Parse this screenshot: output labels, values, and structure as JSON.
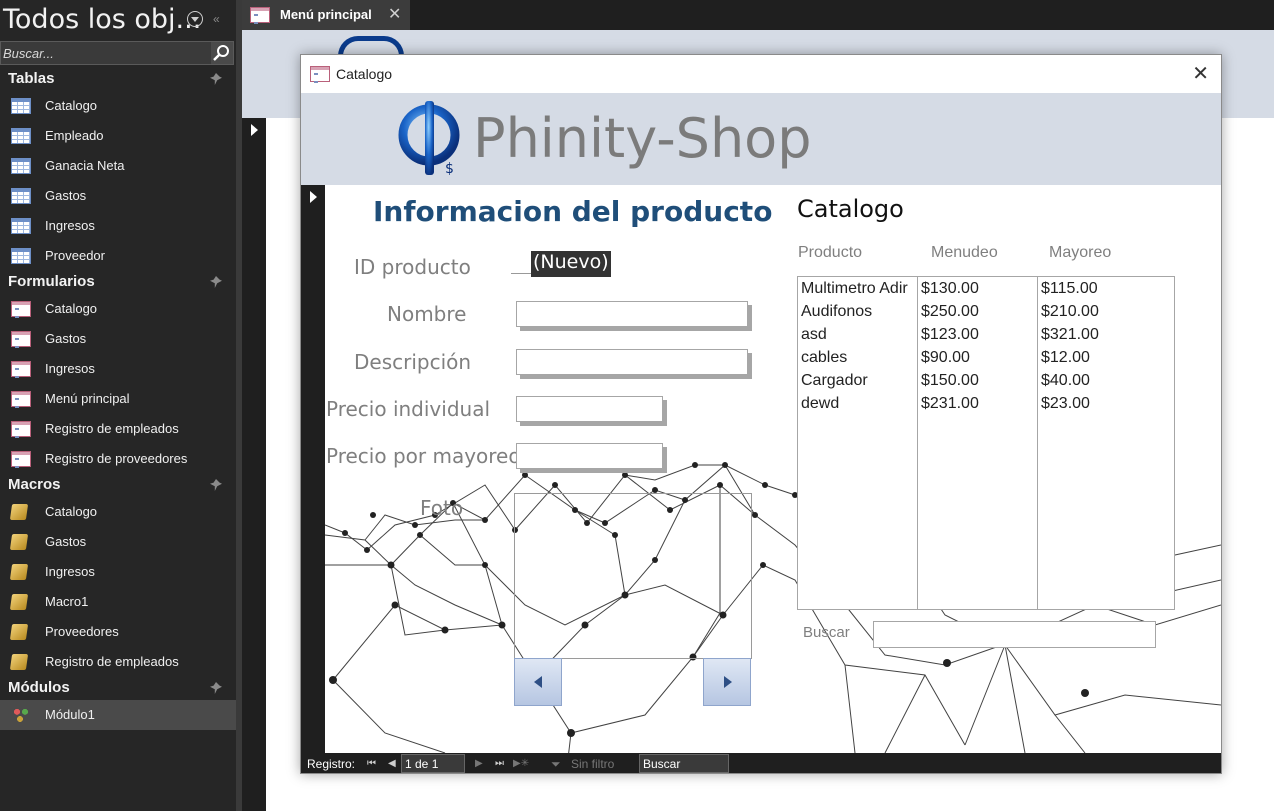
{
  "nav": {
    "title": "Todos los obj...",
    "search_placeholder": "Buscar...",
    "groups": [
      {
        "label": "Tablas",
        "items": [
          {
            "label": "Catalogo"
          },
          {
            "label": "Empleado"
          },
          {
            "label": "Ganacia Neta"
          },
          {
            "label": "Gastos"
          },
          {
            "label": "Ingresos"
          },
          {
            "label": "Proveedor"
          }
        ]
      },
      {
        "label": "Formularios",
        "items": [
          {
            "label": "Catalogo"
          },
          {
            "label": "Gastos"
          },
          {
            "label": "Ingresos"
          },
          {
            "label": "Menú principal"
          },
          {
            "label": "Registro de empleados"
          },
          {
            "label": "Registro de proveedores"
          }
        ]
      },
      {
        "label": "Macros",
        "items": [
          {
            "label": "Catalogo"
          },
          {
            "label": "Gastos"
          },
          {
            "label": "Ingresos"
          },
          {
            "label": "Macro1"
          },
          {
            "label": "Proveedores"
          },
          {
            "label": "Registro de empleados"
          }
        ]
      },
      {
        "label": "Módulos",
        "items": [
          {
            "label": "Módulo1"
          }
        ]
      }
    ]
  },
  "document_tab": {
    "label": "Menú principal"
  },
  "popup": {
    "title": "Catalogo",
    "brand": "Phinity-Shop",
    "form": {
      "title": "Informacion del producto",
      "fields": {
        "id_label": "ID producto",
        "id_value": "(Nuevo)",
        "nombre_label": "Nombre",
        "descripcion_label": "Descripción",
        "precio_ind_label": "Precio individual",
        "precio_may_label": "Precio por mayoreo",
        "foto_label": "Foto"
      }
    },
    "catalog": {
      "title": "Catalogo",
      "columns": [
        "Producto",
        "Menudeo",
        "Mayoreo"
      ],
      "rows": [
        [
          "Multimetro Adir",
          "$130.00",
          "$115.00"
        ],
        [
          "Audifonos",
          "$250.00",
          "$210.00"
        ],
        [
          "asd",
          "$123.00",
          "$321.00"
        ],
        [
          "cables",
          "$90.00",
          "$12.00"
        ],
        [
          "Cargador",
          "$150.00",
          "$40.00"
        ],
        [
          "dewd",
          "$231.00",
          "$23.00"
        ]
      ],
      "search_label": "Buscar"
    },
    "record_nav": {
      "label": "Registro:",
      "position": "1 de 1",
      "filter": "Sin filtro",
      "search": "Buscar"
    }
  },
  "colors": {
    "form_title": "#1f4e79",
    "header_band": "#d5dbe5",
    "nav_bg": "#262626"
  }
}
